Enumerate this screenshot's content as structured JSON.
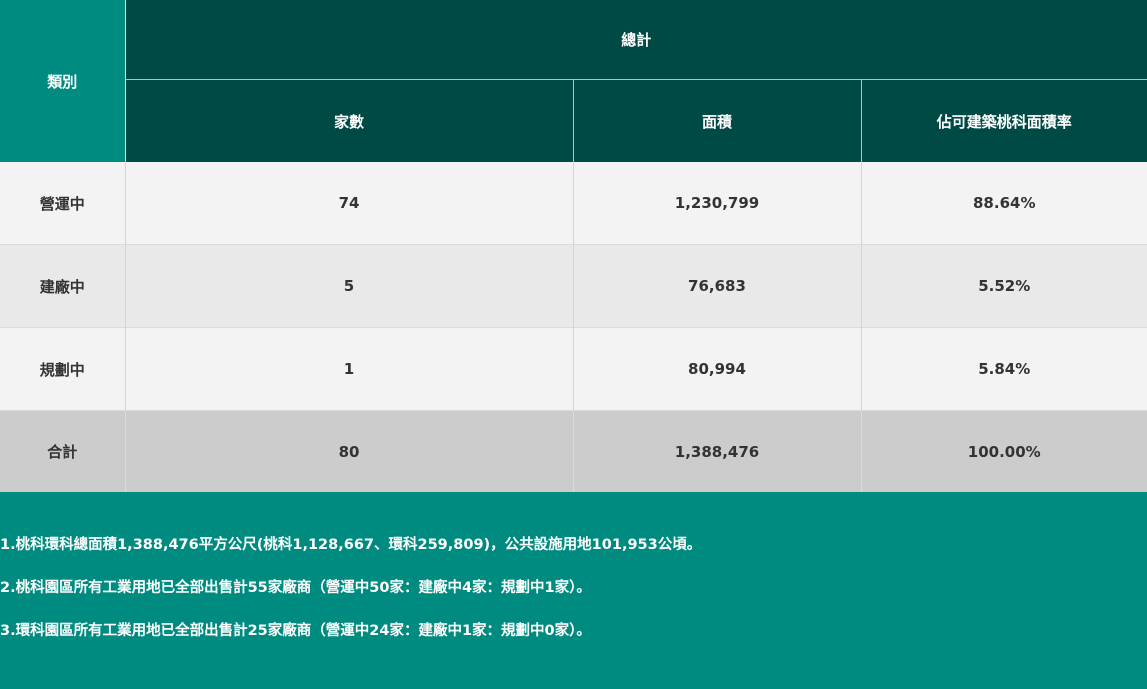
{
  "table": {
    "category_header": "類別",
    "group_header": "總計",
    "columns": [
      "家數",
      "面積",
      "佔可建築桃科面積率"
    ],
    "rows": [
      {
        "label": "營運中",
        "count": "74",
        "area": "1,230,799",
        "ratio": "88.64%"
      },
      {
        "label": "建廠中",
        "count": "5",
        "area": "76,683",
        "ratio": "5.52%"
      },
      {
        "label": "規劃中",
        "count": "1",
        "area": "80,994",
        "ratio": "5.84%"
      }
    ],
    "total": {
      "label": "合計",
      "count": "80",
      "area": "1,388,476",
      "ratio": "100.00%"
    }
  },
  "notes": [
    "1.桃科環科總面積1,388,476平方公尺(桃科1,128,667、環科259,809)，公共設施用地101,953公頃。",
    "2.桃科園區所有工業用地已全部出售計55家廠商（營運中50家：建廠中4家：規劃中1家）。",
    "3.環科園區所有工業用地已全部出售計25家廠商（營運中24家：建廠中1家：規劃中0家）。"
  ],
  "colors": {
    "header_dark": "#004a45",
    "header_teal": "#008b80",
    "row_light": "#f3f3f3",
    "row_mid": "#e9e9e9",
    "row_total": "#cccccc"
  }
}
